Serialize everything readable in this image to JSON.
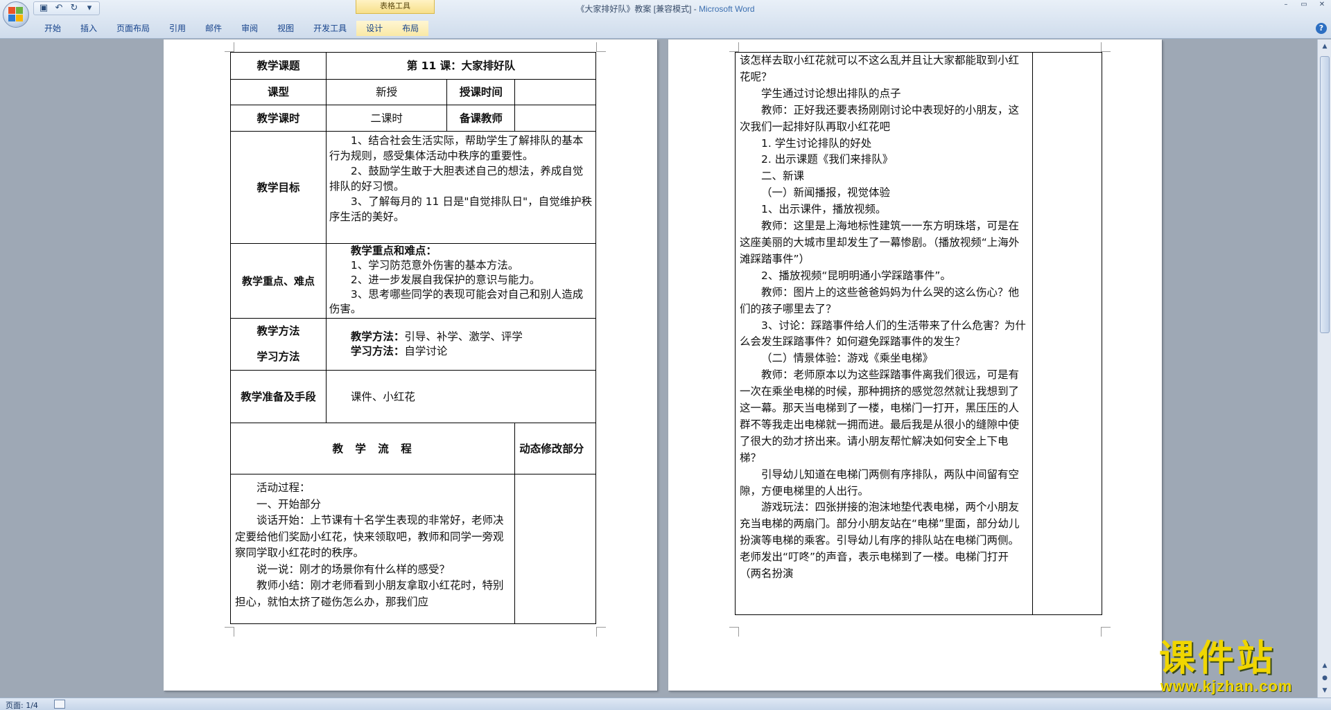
{
  "window": {
    "title_doc": "《大家排好队》教案 [兼容模式] - ",
    "title_app": "Microsoft Word",
    "context_tab_group": "表格工具"
  },
  "qat": {
    "icons": [
      "save-icon",
      "undo-icon",
      "redo-icon",
      "customize-qat-icon"
    ]
  },
  "ribbon": {
    "tabs": [
      "开始",
      "插入",
      "页面布局",
      "引用",
      "邮件",
      "审阅",
      "视图",
      "开发工具",
      "设计",
      "布局"
    ],
    "help": "?"
  },
  "page1": {
    "topic_label": "教学课题",
    "topic_value": "第 11 课：大家排好队",
    "type_label": "课型",
    "type_value": "新授",
    "time_label": "授课时间",
    "hours_label": "教学课时",
    "hours_value": "二课时",
    "teacher_label": "备课教师",
    "goals_label": "教学目标",
    "goals": [
      "1、结合社会生活实际，帮助学生了解排队的基本行为规则，感受集体活动中秩序的重要性。",
      "2、鼓励学生敢于大胆表述自己的想法，养成自觉排队的好习惯。",
      "3、了解每月的 11 日是\"自觉排队日\"，自觉维护秩序生活的美好。"
    ],
    "keypoints_label": "教学重点、难点",
    "keypoints_title": "教学重点和难点：",
    "keypoints": [
      "1、学习防范意外伤害的基本方法。",
      "2、进一步发展自我保护的意识与能力。",
      "3、思考哪些同学的表现可能会对自己和别人造成伤害。"
    ],
    "methods_label_1": "教学方法",
    "methods_label_2": "学习方法",
    "teach_method_title": "教学方法：",
    "teach_method_value": "引导、补学、激学、评学",
    "learn_method_title": "学习方法：",
    "learn_method_value": "自学讨论",
    "prep_label": "教学准备及手段",
    "prep_value": "课件、小红花",
    "flow_label": "教 学 流 程",
    "revise_label": "动态修改部分",
    "flow": [
      "活动过程：",
      "一、开始部分",
      "谈话开始：上节课有十名学生表现的非常好，老师决定要给他们奖励小红花，快来领取吧，教师和同学一旁观察同学取小红花时的秩序。",
      "说一说：刚才的场景你有什么样的感受？",
      "教师小结：刚才老师看到小朋友拿取小红花时，特别担心，就怕太挤了碰伤怎么办，那我们应"
    ]
  },
  "page2": {
    "paras": [
      {
        "t": "该怎样去取小红花就可以不这么乱并且让大家都能取到小红花呢？",
        "indent": false
      },
      {
        "t": "学生通过讨论想出排队的点子",
        "indent": true
      },
      {
        "t": "教师：正好我还要表扬刚刚讨论中表现好的小朋友，这次我们一起排好队再取小红花吧",
        "indent": true
      },
      {
        "t": "1. 学生讨论排队的好处",
        "indent": true
      },
      {
        "t": "2. 出示课题《我们来排队》",
        "indent": true
      },
      {
        "t": "二、新课",
        "indent": true
      },
      {
        "t": "（一）新闻播报，视觉体验",
        "indent": true
      },
      {
        "t": "1、出示课件，播放视频。",
        "indent": true
      },
      {
        "t": "教师：这里是上海地标性建筑一一东方明珠塔，可是在这座美丽的大城市里却发生了一幕惨剧。（播放视频“上海外滩踩踏事件”）",
        "indent": true
      },
      {
        "t": "2、播放视频“昆明明通小学踩踏事件”。",
        "indent": true
      },
      {
        "t": "教师：图片上的这些爸爸妈妈为什么哭的这么伤心？他们的孩子哪里去了？",
        "indent": true
      },
      {
        "t": "3、讨论：踩踏事件给人们的生活带来了什么危害？为什么会发生踩踏事件？如何避免踩踏事件的发生？",
        "indent": true
      },
      {
        "t": "（二）情景体验：游戏《乘坐电梯》",
        "indent": true
      },
      {
        "t": "教师：老师原本以为这些踩踏事件离我们很远，可是有一次在乘坐电梯的时候，那种拥挤的感觉忽然就让我想到了这一幕。那天当电梯到了一楼，电梯门一打开，黑压压的人群不等我走出电梯就一拥而进。最后我是从很小的缝隙中使了很大的劲才挤出来。请小朋友帮忙解决如何安全上下电梯？",
        "indent": true
      },
      {
        "t": "引导幼儿知道在电梯门两侧有序排队，两队中间留有空隙，方便电梯里的人出行。",
        "indent": true
      },
      {
        "t": "游戏玩法：四张拼接的泡沫地垫代表电梯，两个小朋友充当电梯的两扇门。部分小朋友站在“电梯”里面，部分幼儿扮演等电梯的乘客。引导幼儿有序的排队站在电梯门两侧。老师发出“叮咚”的声音，表示电梯到了一楼。电梯门打开（两名扮演",
        "indent": true
      }
    ]
  },
  "status": {
    "page_count": "页面: 1/4"
  },
  "watermark": {
    "text": "课件站",
    "url": "www.kjzhan.com"
  }
}
